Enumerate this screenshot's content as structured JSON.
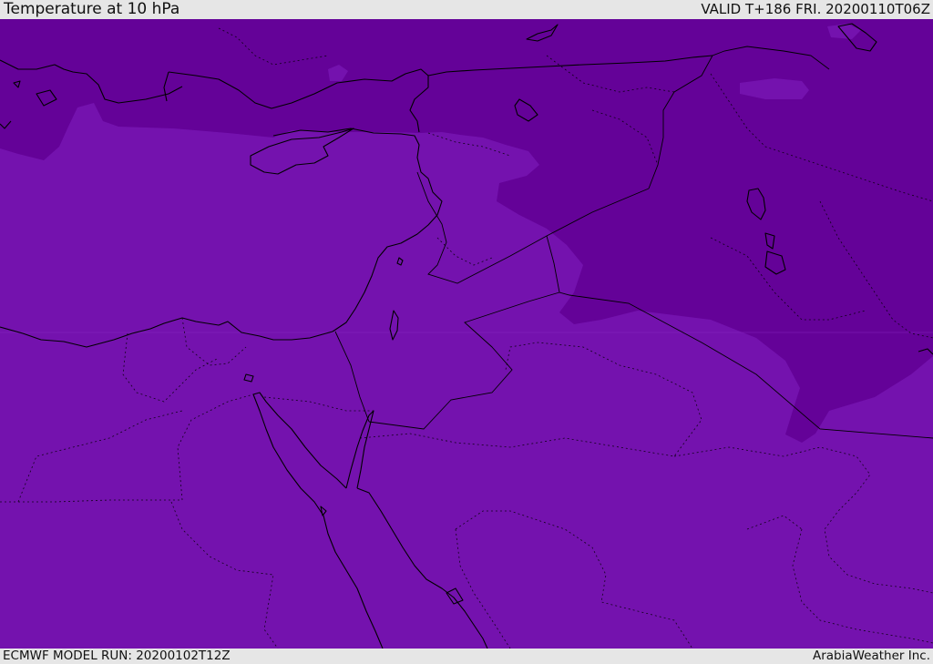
{
  "header": {
    "title": "Temperature at 10 hPa",
    "valid": "VALID T+186 FRI. 20200110T06Z"
  },
  "footer": {
    "model_run": "ECMWF MODEL RUN: 20200102T12Z",
    "credit": "ArabiaWeather Inc."
  },
  "colors": {
    "field_dark": "#640298",
    "field_mid": "#7412ae",
    "coast": "#000000",
    "chrome": "#e6e6e6"
  }
}
